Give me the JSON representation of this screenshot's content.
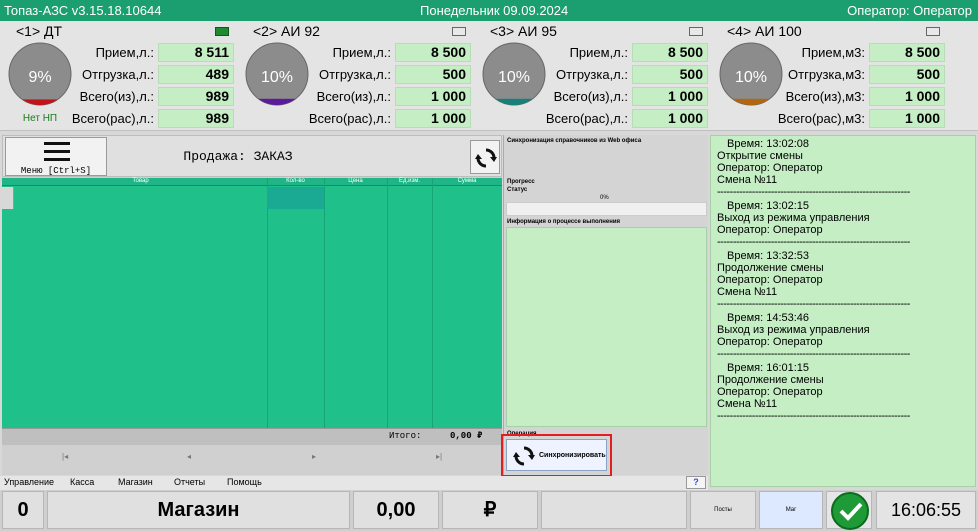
{
  "titlebar": {
    "app": "Топаз-АЗС  v3.15.18.10644",
    "date": "Понедельник 09.09.2024",
    "operator": "Оператор: Оператор"
  },
  "tanks": [
    {
      "title": "<1> ДТ",
      "percent": "9%",
      "level": 0.09,
      "color": "#c0141a",
      "indicator_on": true,
      "note": "Нет НП",
      "rows": [
        {
          "label": "Прием,л.:",
          "value": "8 511"
        },
        {
          "label": "Отгрузка,л.:",
          "value": "489"
        },
        {
          "label": "Всего(из),л.:",
          "value": "989"
        },
        {
          "label": "Всего(рас),л.:",
          "value": "989"
        }
      ]
    },
    {
      "title": "<2> АИ 92",
      "percent": "10%",
      "level": 0.1,
      "color": "#5b1a9a",
      "indicator_on": false,
      "note": "",
      "rows": [
        {
          "label": "Прием,л.:",
          "value": "8 500"
        },
        {
          "label": "Отгрузка,л.:",
          "value": "500"
        },
        {
          "label": "Всего(из),л.:",
          "value": "1 000"
        },
        {
          "label": "Всего(рас),л.:",
          "value": "1 000"
        }
      ]
    },
    {
      "title": "<3> АИ 95",
      "percent": "10%",
      "level": 0.1,
      "color": "#16807a",
      "indicator_on": false,
      "note": "",
      "rows": [
        {
          "label": "Прием,л.:",
          "value": "8 500"
        },
        {
          "label": "Отгрузка,л.:",
          "value": "500"
        },
        {
          "label": "Всего(из),л.:",
          "value": "1 000"
        },
        {
          "label": "Всего(рас),л.:",
          "value": "1 000"
        }
      ]
    },
    {
      "title": "<4> АИ 100",
      "percent": "10%",
      "level": 0.1,
      "color": "#b2660f",
      "indicator_on": false,
      "note": "",
      "rows": [
        {
          "label": "Прием,м3:",
          "value": "8 500"
        },
        {
          "label": "Отгрузка,м3:",
          "value": "500"
        },
        {
          "label": "Всего(из),м3:",
          "value": "1 000"
        },
        {
          "label": "Всего(рас),м3:",
          "value": "1 000"
        }
      ]
    }
  ],
  "sale": {
    "menu_label": "Меню [Ctrl+S]",
    "title": "Продажа: ЗАКАЗ",
    "columns": [
      "Товар",
      "Кол-во",
      "Цена",
      "Ед.изм.",
      "Сумма"
    ],
    "total_label": "Итого:",
    "total_value": "0,00 ₽"
  },
  "sync": {
    "heading": "Синхронизация справочников из Web офиса",
    "progress_label": "Прогресс",
    "status_label": "Статус",
    "progress_value": "0%",
    "progress": 0,
    "info_label": "Информация о процессе выполнения",
    "operation_label": "Операция",
    "button_label": "Синхронизировать"
  },
  "log": [
    {
      "time": "Время: 13:02:08",
      "lines": [
        "Открытие смены",
        "Оператор: Оператор",
        "Смена №11"
      ]
    },
    {
      "time": "Время: 13:02:15",
      "lines": [
        "Выход из режима управления",
        "Оператор: Оператор"
      ]
    },
    {
      "time": "Время: 13:32:53",
      "lines": [
        "Продолжение смены",
        "Оператор: Оператор",
        "Смена №11"
      ]
    },
    {
      "time": "Время: 14:53:46",
      "lines": [
        "Выход из режима управления",
        "Оператор: Оператор"
      ]
    },
    {
      "time": "Время: 16:01:15",
      "lines": [
        "Продолжение смены",
        "Оператор: Оператор",
        "Смена №11"
      ]
    }
  ],
  "menubar": {
    "items": [
      "Управление",
      "Касса",
      "Магазин",
      "Отчеты",
      "Помощь"
    ],
    "help": "?"
  },
  "bottom": {
    "count": "0",
    "mode": "Магазин",
    "amount": "0,00",
    "currency": "₽",
    "posts": "Посты",
    "mag": "Маг",
    "clock": "16:06:55"
  }
}
